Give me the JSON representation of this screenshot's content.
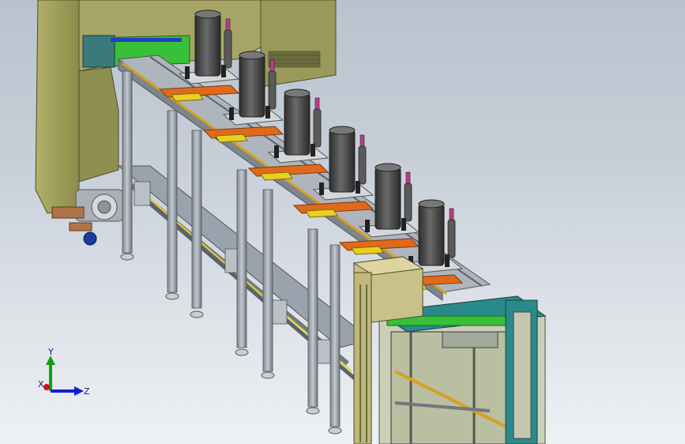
{
  "view_triad": {
    "x_label": "X",
    "y_label": "Y",
    "z_label": "Z",
    "colors": {
      "x": "#d01010",
      "y": "#10a010",
      "z": "#1020d0"
    }
  },
  "model": {
    "units": [
      "unit-1",
      "unit-2",
      "unit-3",
      "unit-4",
      "unit-5",
      "unit-6"
    ],
    "colors": {
      "frame": "#9aa3ad",
      "cabinet": "#9a9a55",
      "cylinder": "#4a4a4a",
      "rail_orange": "#e06a1a",
      "pad_yellow": "#e8d020",
      "pad_green": "#39c039",
      "cover_teal": "#2a8a8a",
      "control_box": "#c9c08a"
    }
  }
}
